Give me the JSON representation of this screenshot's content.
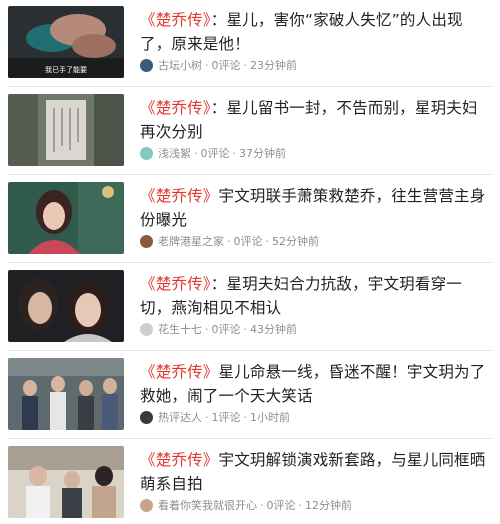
{
  "items": [
    {
      "drama": "《楚乔传》",
      "headline": "：星儿，害你“家破人失忆”的人出现了，原来是他！",
      "author": "古坛小树",
      "comments": "0评论",
      "time": "23分钟前",
      "thumb_caption": "我已手了能要",
      "avatar_color": "#3b5b7a"
    },
    {
      "drama": "《楚乔传》",
      "headline": "：星儿留书一封，不告而别，星玥夫妇再次分别",
      "author": "浅浅絮",
      "comments": "0评论",
      "time": "37分钟前",
      "avatar_color": "#7fc9c0"
    },
    {
      "drama": "《楚乔传》",
      "headline": "宇文玥联手萧策救楚乔，往生营营主身份曝光",
      "author": "老牌港星之家",
      "comments": "0评论",
      "time": "52分钟前",
      "avatar_color": "#8a5a3c"
    },
    {
      "drama": "《楚乔传》",
      "headline": "：星玥夫妇合力抗敌，宇文玥看穿一切，燕洵相见不相认",
      "author": "花生十七",
      "comments": "0评论",
      "time": "43分钟前",
      "avatar_color": "#cfcfcf"
    },
    {
      "drama": "《楚乔传》",
      "headline": "星儿命悬一线，昏迷不醒！宇文玥为了救她，闹了一个天大笑话",
      "author": "热评达人",
      "comments": "1评论",
      "time": "1小时前",
      "avatar_color": "#3a3a3a"
    },
    {
      "drama": "《楚乔传》",
      "headline": "宇文玥解锁演戏新套路，与星儿同框晒萌系自拍",
      "author": "看着你笑我就很开心",
      "comments": "0评论",
      "time": "12分钟前",
      "avatar_color": "#c9a48a"
    }
  ]
}
